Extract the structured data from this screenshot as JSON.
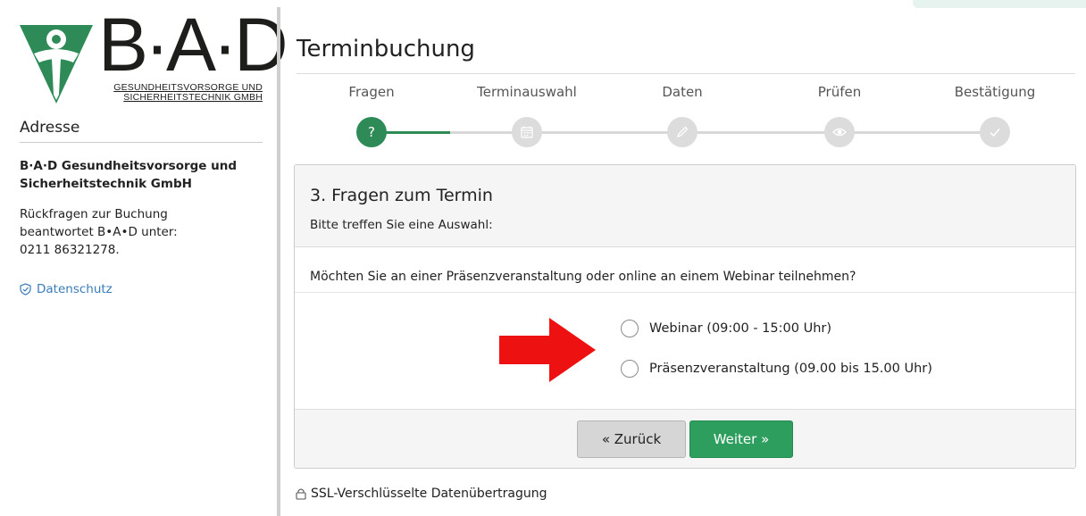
{
  "brand": {
    "logo_text": "B·A·D",
    "logo_sub_line1": "GESUNDHEITSVORSORGE UND",
    "logo_sub_line2": "SICHERHEITSTECHNIK GMBH",
    "green": "#2e8b57"
  },
  "sidebar": {
    "address_heading": "Adresse",
    "company_line1": "B·A·D Gesundheitsvorsorge und",
    "company_line2": "Sicherheitstechnik GmbH",
    "contact_line1": "Rückfragen zur Buchung",
    "contact_line2": "beantwortet B•A•D unter:",
    "contact_phone": "0211 86321278.",
    "privacy_link": "Datenschutz",
    "privacy_icon": "shield-check-icon"
  },
  "page": {
    "title": "Terminbuchung"
  },
  "steps": [
    {
      "label": "Fragen",
      "icon": "question-icon",
      "glyph": "?",
      "active": true
    },
    {
      "label": "Terminauswahl",
      "icon": "calendar-icon",
      "active": false
    },
    {
      "label": "Daten",
      "icon": "pencil-icon",
      "active": false
    },
    {
      "label": "Prüfen",
      "icon": "eye-icon",
      "active": false
    },
    {
      "label": "Bestätigung",
      "icon": "check-icon",
      "active": false
    }
  ],
  "panel": {
    "title": "3. Fragen zum Termin",
    "subtitle": "Bitte treffen Sie eine Auswahl:",
    "question": "Möchten Sie an einer Präsenzveranstaltung oder online an einem Webinar teilnehmen?",
    "options": [
      {
        "label": "Webinar (09:00 - 15:00 Uhr)",
        "selected": false
      },
      {
        "label": "Präsenzveranstaltung (09.00 bis 15.00 Uhr)",
        "selected": false
      }
    ],
    "annotation_arrow_color": "#ee1111"
  },
  "buttons": {
    "back_label": "« Zurück",
    "next_label": "Weiter »"
  },
  "footer": {
    "ssl_text": "SSL-Verschlüsselte Datenübertragung",
    "ssl_icon": "lock-icon"
  }
}
